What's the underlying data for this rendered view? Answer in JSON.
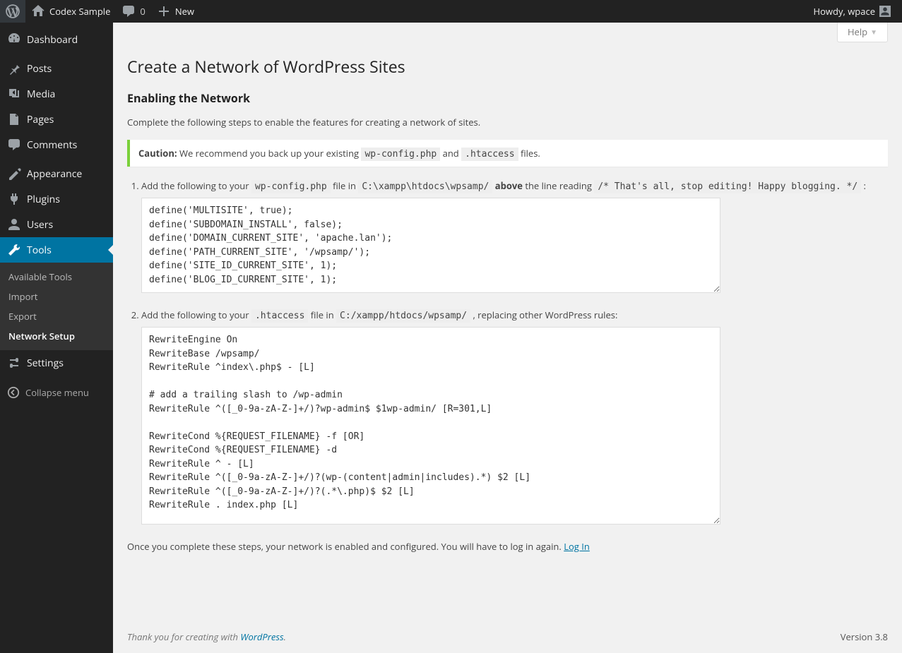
{
  "adminbar": {
    "site_title": "Codex Sample",
    "comments_count": "0",
    "new_label": "New",
    "howdy_prefix": "Howdy, ",
    "username": "wpace"
  },
  "sidebar": {
    "items": [
      {
        "label": "Dashboard"
      },
      {
        "label": "Posts"
      },
      {
        "label": "Media"
      },
      {
        "label": "Pages"
      },
      {
        "label": "Comments"
      },
      {
        "label": "Appearance"
      },
      {
        "label": "Plugins"
      },
      {
        "label": "Users"
      },
      {
        "label": "Tools"
      },
      {
        "label": "Settings"
      }
    ],
    "tools_submenu": [
      {
        "label": "Available Tools"
      },
      {
        "label": "Import"
      },
      {
        "label": "Export"
      },
      {
        "label": "Network Setup"
      }
    ],
    "collapse_label": "Collapse menu"
  },
  "screen": {
    "help_label": "Help"
  },
  "page": {
    "title": "Create a Network of WordPress Sites",
    "section_title": "Enabling the Network",
    "intro": "Complete the following steps to enable the features for creating a network of sites.",
    "caution_strong": "Caution:",
    "caution_before": " We recommend you back up your existing ",
    "caution_code1": "wp-config.php",
    "caution_mid": " and ",
    "caution_code2": ".htaccess",
    "caution_after": " files.",
    "step1": {
      "lead": "Add the following to your ",
      "code_a": "wp-config.php",
      "mid1": " file in ",
      "code_b": "C:\\xampp\\htdocs\\wpsamp/",
      "mid2": " ",
      "above": "above",
      "mid3": " the line reading ",
      "code_c": "/* That's all, stop editing! Happy blogging. */",
      "tail": " :",
      "code": "define('MULTISITE', true);\ndefine('SUBDOMAIN_INSTALL', false);\ndefine('DOMAIN_CURRENT_SITE', 'apache.lan');\ndefine('PATH_CURRENT_SITE', '/wpsamp/');\ndefine('SITE_ID_CURRENT_SITE', 1);\ndefine('BLOG_ID_CURRENT_SITE', 1);"
    },
    "step2": {
      "lead": "Add the following to your ",
      "code_a": ".htaccess",
      "mid1": " file in ",
      "code_b": "C:/xampp/htdocs/wpsamp/",
      "tail": " , replacing other WordPress rules:",
      "code": "RewriteEngine On\nRewriteBase /wpsamp/\nRewriteRule ^index\\.php$ - [L]\n\n# add a trailing slash to /wp-admin\nRewriteRule ^([_0-9a-zA-Z-]+/)?wp-admin$ $1wp-admin/ [R=301,L]\n\nRewriteCond %{REQUEST_FILENAME} -f [OR]\nRewriteCond %{REQUEST_FILENAME} -d\nRewriteRule ^ - [L]\nRewriteRule ^([_0-9a-zA-Z-]+/)?(wp-(content|admin|includes).*) $2 [L]\nRewriteRule ^([_0-9a-zA-Z-]+/)?(.*\\.php)$ $2 [L]\nRewriteRule . index.php [L]"
    },
    "done_text": "Once you complete these steps, your network is enabled and configured. You will have to log in again. ",
    "login_link": "Log In"
  },
  "footer": {
    "thanks_before": "Thank you for creating with ",
    "thanks_link": "WordPress",
    "thanks_after": ".",
    "version": "Version 3.8"
  }
}
